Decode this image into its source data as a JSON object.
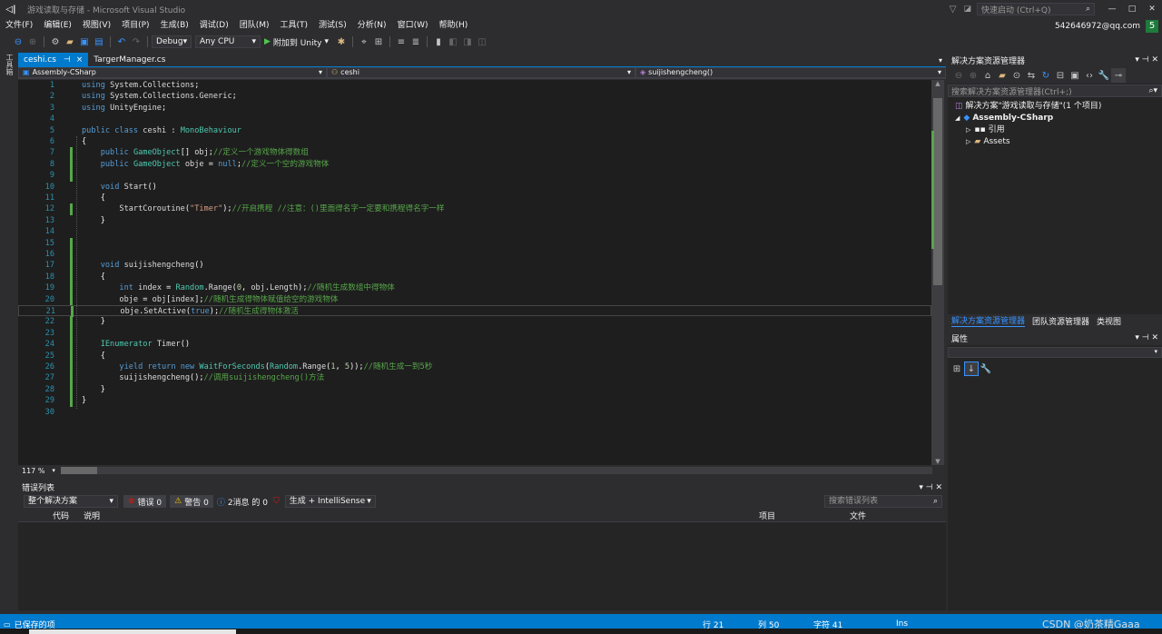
{
  "window": {
    "title": "游戏读取与存储 - Microsoft Visual Studio",
    "quick_launch": "快速启动 (Ctrl+Q)",
    "user": "542646972@qq.com",
    "notif_count": "5"
  },
  "menu": [
    "文件(F)",
    "编辑(E)",
    "视图(V)",
    "项目(P)",
    "生成(B)",
    "调试(D)",
    "团队(M)",
    "工具(T)",
    "测试(S)",
    "分析(N)",
    "窗口(W)",
    "帮助(H)"
  ],
  "toolbar": {
    "config": "Debug",
    "platform": "Any CPU",
    "attach": "附加到 Unity"
  },
  "left_strip_label": "工具箱",
  "tabs": [
    {
      "label": "ceshi.cs",
      "active": true,
      "pin": "⊣",
      "close": "×"
    },
    {
      "label": "TargerManager.cs",
      "active": false
    }
  ],
  "navbar": {
    "project": "Assembly-CSharp",
    "class": "ceshi",
    "member": "suijishengcheng()"
  },
  "code": [
    {
      "n": "1",
      "t": "using System.Collections;",
      "c": false
    },
    {
      "n": "2",
      "t": "using System.Collections.Generic;",
      "c": false
    },
    {
      "n": "3",
      "t": "using UnityEngine;",
      "c": false
    },
    {
      "n": "4",
      "t": "",
      "c": false
    },
    {
      "n": "5",
      "t": "public class ceshi : MonoBehaviour",
      "c": false
    },
    {
      "n": "6",
      "t": "{",
      "c": false
    },
    {
      "n": "7",
      "t": "    public GameObject[] obj;//定义一个游戏物体得数组",
      "c": true
    },
    {
      "n": "8",
      "t": "    public GameObject obje = null;//定义一个空的游戏物体",
      "c": true
    },
    {
      "n": "9",
      "t": "",
      "c": true
    },
    {
      "n": "10",
      "t": "    void Start()",
      "c": false
    },
    {
      "n": "11",
      "t": "    {",
      "c": false
    },
    {
      "n": "12",
      "t": "        StartCoroutine(\"Timer\");//开启携程 //注意：()里面得名字一定要和携程得名字一样",
      "c": true
    },
    {
      "n": "13",
      "t": "    }",
      "c": false
    },
    {
      "n": "14",
      "t": "",
      "c": false
    },
    {
      "n": "15",
      "t": "",
      "c": true
    },
    {
      "n": "16",
      "t": "",
      "c": true
    },
    {
      "n": "17",
      "t": "    void suijishengcheng()",
      "c": true
    },
    {
      "n": "18",
      "t": "    {",
      "c": true
    },
    {
      "n": "19",
      "t": "        int index = Random.Range(0, obj.Length);//随机生成数组中得物体",
      "c": true
    },
    {
      "n": "20",
      "t": "        obje = obj[index];//随机生成得物体赋值给空的游戏物体",
      "c": true
    },
    {
      "n": "21",
      "t": "        obje.SetActive(true);//随机生成得物体激活",
      "c": true
    },
    {
      "n": "22",
      "t": "    }",
      "c": true
    },
    {
      "n": "23",
      "t": "",
      "c": true
    },
    {
      "n": "24",
      "t": "    IEnumerator Timer()",
      "c": true
    },
    {
      "n": "25",
      "t": "    {",
      "c": true
    },
    {
      "n": "26",
      "t": "        yield return new WaitForSeconds(Random.Range(1, 5));//随机生成一到5秒",
      "c": true
    },
    {
      "n": "27",
      "t": "        suijishengcheng();//调用suijishengcheng()方法",
      "c": true
    },
    {
      "n": "28",
      "t": "    }",
      "c": true
    },
    {
      "n": "29",
      "t": "}",
      "c": true
    },
    {
      "n": "30",
      "t": "",
      "c": false
    }
  ],
  "zoom": "117 %",
  "errors": {
    "title": "错误列表",
    "scope": "整个解决方案",
    "err_label": "错误 0",
    "warn_label": "警告 0",
    "msg_label": "2消息 的 0",
    "build": "生成 + IntelliSense",
    "search": "搜索错误列表",
    "columns": [
      "代码",
      "说明",
      "项目",
      "文件"
    ]
  },
  "solution_explorer": {
    "title": "解决方案资源管理器",
    "search": "搜索解决方案资源管理器(Ctrl+;)",
    "items": [
      {
        "label": "解决方案\"游戏读取与存储\"(1 个项目)",
        "indent": 0,
        "bold": false
      },
      {
        "label": "Assembly-CSharp",
        "indent": 1,
        "bold": true
      },
      {
        "label": "引用",
        "indent": 2,
        "bold": false
      },
      {
        "label": "Assets",
        "indent": 2,
        "bold": false
      }
    ],
    "tabs": [
      "解决方案资源管理器",
      "团队资源管理器",
      "类视图"
    ]
  },
  "properties": {
    "title": "属性"
  },
  "status": {
    "left": "已保存的项",
    "line": "行 21",
    "col": "列 50",
    "char": "字符 41",
    "mode": "Ins",
    "watermark": "CSDN @奶茶精Gaaa"
  }
}
